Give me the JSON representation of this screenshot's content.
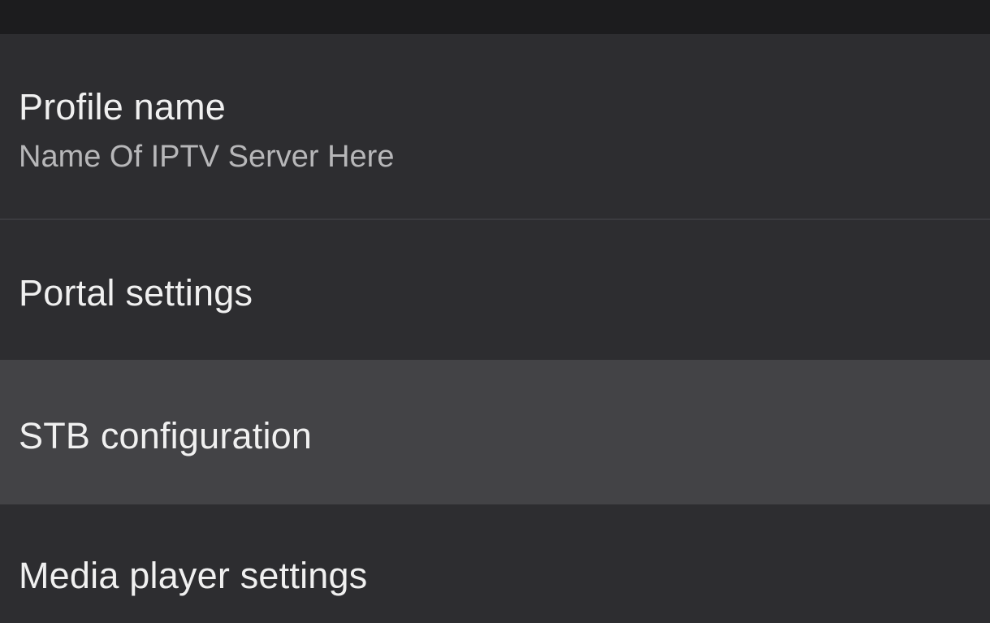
{
  "settings": {
    "items": [
      {
        "title": "Profile name",
        "summary": "Name Of IPTV Server Here"
      },
      {
        "title": "Portal settings"
      },
      {
        "title": "STB configuration"
      },
      {
        "title": "Media player settings"
      }
    ]
  },
  "colors": {
    "background": "#2d2d30",
    "top_bar": "#1c1c1e",
    "highlighted_item": "#434346",
    "title_text": "#f0f0f0",
    "summary_text": "#b7b7b9"
  }
}
